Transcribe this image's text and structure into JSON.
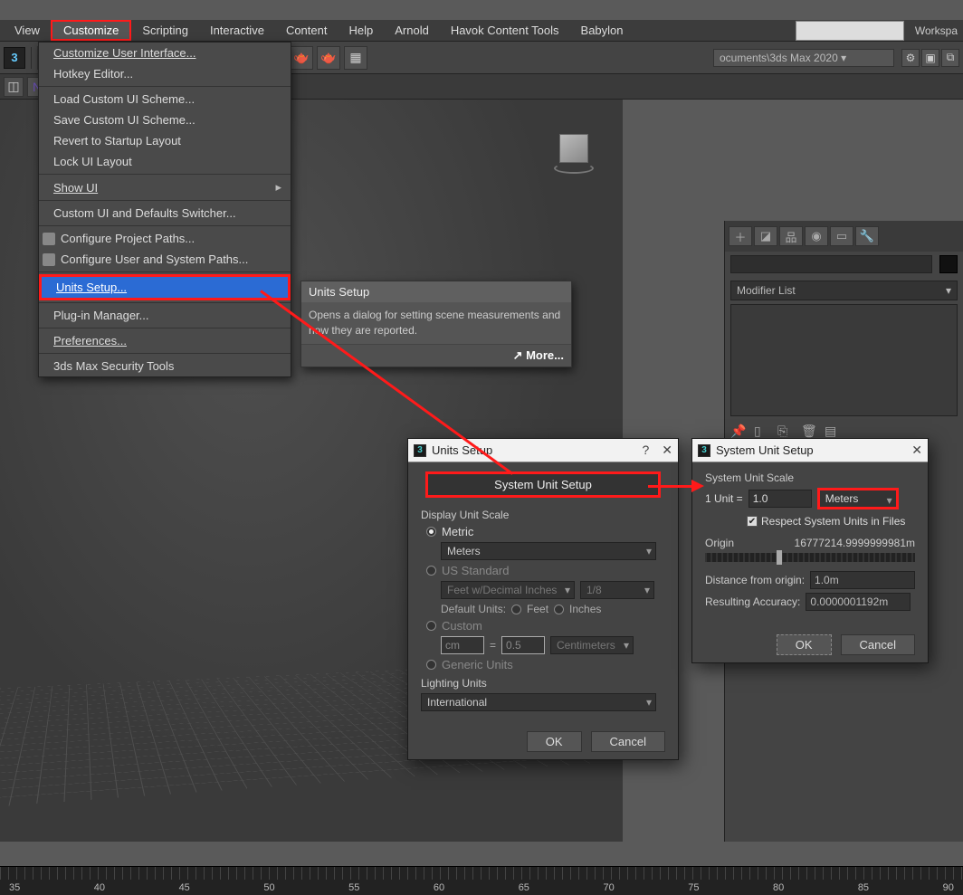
{
  "menubar": {
    "items": [
      "View",
      "Customize",
      "Scripting",
      "Interactive",
      "Content",
      "Help",
      "Arnold",
      "Havok Content Tools",
      "Babylon"
    ],
    "active_index": 1
  },
  "workspace_label": "Workspa",
  "path_display": "ocuments\\3ds Max 2020  ▾",
  "toolbar_logo": "3",
  "dropdown": {
    "items": [
      {
        "label": "Customize User Interface...",
        "ul": "C"
      },
      {
        "label": "Hotkey Editor..."
      },
      {
        "sep": true
      },
      {
        "label": "Load Custom UI Scheme..."
      },
      {
        "label": "Save Custom UI Scheme..."
      },
      {
        "label": "Revert to Startup Layout"
      },
      {
        "label": "Lock UI Layout"
      },
      {
        "sep": true
      },
      {
        "label": "Show UI",
        "ul": "S",
        "sub": true
      },
      {
        "sep": true
      },
      {
        "label": "Custom UI and Defaults Switcher..."
      },
      {
        "sep": true
      },
      {
        "label": "Configure Project Paths...",
        "icon": true
      },
      {
        "label": "Configure User and System Paths...",
        "icon": true
      },
      {
        "sep": true
      },
      {
        "label": "Units Setup...",
        "ul": "U",
        "hl": true
      },
      {
        "sep": true
      },
      {
        "label": "Plug-in Manager..."
      },
      {
        "sep": true
      },
      {
        "label": "Preferences...",
        "ul": "P"
      },
      {
        "sep": true
      },
      {
        "label": "3ds Max Security Tools"
      }
    ]
  },
  "tooltip": {
    "title": "Units Setup",
    "body": "Opens a dialog for setting scene measurements and how they are reported.",
    "more": "More..."
  },
  "rightpanel": {
    "modifier_label": "Modifier List"
  },
  "dialog1": {
    "title": "Units Setup",
    "help": "?",
    "close": "✕",
    "sys_btn": "System Unit Setup",
    "group_display": "Display Unit Scale",
    "metric_label": "Metric",
    "metric_select": "Meters",
    "us_label": "US Standard",
    "us_select": "Feet w/Decimal Inches",
    "us_frac": "1/8",
    "default_units_label": "Default Units:",
    "feet": "Feet",
    "inches": "Inches",
    "custom_label": "Custom",
    "custom_unit": "cm",
    "custom_eq": "=",
    "custom_val": "0.5",
    "custom_sel": "Centimeters",
    "generic_label": "Generic Units",
    "lighting_label": "Lighting Units",
    "lighting_select": "International",
    "ok": "OK",
    "cancel": "Cancel"
  },
  "dialog2": {
    "title": "System Unit Setup",
    "close": "✕",
    "scale_label": "System Unit Scale",
    "one_unit": "1 Unit =",
    "unit_value": "1.0",
    "unit_select": "Meters",
    "respect": "Respect System Units in Files",
    "origin_label": "Origin",
    "origin_value": "16777214.9999999981m",
    "distance_label": "Distance from origin:",
    "distance_value": "1.0m",
    "accuracy_label": "Resulting Accuracy:",
    "accuracy_value": "0.0000001192m",
    "ok": "OK",
    "cancel": "Cancel"
  },
  "timeline": {
    "labels": [
      "35",
      "40",
      "45",
      "50",
      "55",
      "60",
      "65",
      "70",
      "75",
      "80",
      "85",
      "90"
    ]
  }
}
